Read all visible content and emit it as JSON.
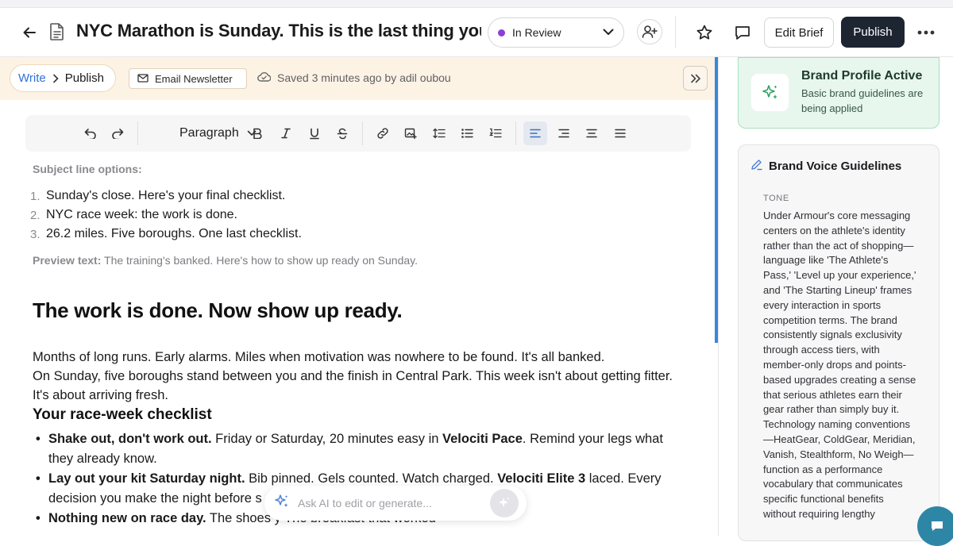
{
  "header": {
    "title": "NYC Marathon is Sunday. This is the last thing you s",
    "status": "In Review",
    "edit_brief_label": "Edit Brief",
    "publish_label": "Publish"
  },
  "subbar": {
    "crumb_write": "Write",
    "crumb_publish": "Publish",
    "email_newsletter": "Email Newsletter",
    "saved_text": "Saved 3 minutes ago by adil oubou"
  },
  "toolbar": {
    "paragraph_label": "Paragraph"
  },
  "doc": {
    "subject_label": "Subject line options:",
    "subject_lines": [
      {
        "num": "1.",
        "text": "Sunday's close. Here's your final checklist."
      },
      {
        "num": "2.",
        "text": "NYC race week: the work is done."
      },
      {
        "num": "3.",
        "text": "26.2 miles. Five boroughs. One last checklist."
      }
    ],
    "preview_label": "Preview text:",
    "preview_text": " The training's banked. Here's how to show up ready on Sunday.",
    "headline": "The work is done. Now show up ready.",
    "para1": "Months of long runs. Early alarms. Miles when motivation was nowhere to be found. It's all banked.",
    "para2": "On Sunday, five boroughs stand between you and the finish in Central Park. This week isn't about getting fitter. It's about arriving fresh.",
    "checklist_heading": "Your race-week checklist",
    "checklist": [
      {
        "bold": "Shake out, don't work out.",
        "text1": " Friday or Saturday, 20 minutes easy in ",
        "bold2": "Velociti Pace",
        "text2": ". Remind your legs what they already know."
      },
      {
        "bold": "Lay out your kit Saturday night.",
        "text1": " Bib pinned. Gels counted. Watch charged. ",
        "bold2": "Velociti Elite 3",
        "text2": " laced. Every decision you make the night before s"
      },
      {
        "bold": "Nothing new on race day.",
        "text1": " The shoes y",
        "bold2": "",
        "text2": "   The breakfast that worked"
      }
    ]
  },
  "ai": {
    "placeholder": "Ask AI to edit or generate..."
  },
  "brand": {
    "title": "Brand Profile Active",
    "subtitle": "Basic brand guidelines are being applied"
  },
  "guidelines": {
    "title": "Brand Voice Guidelines",
    "tone_label": "TONE",
    "tone_text": "Under Armour's core messaging centers on the athlete's identity rather than the act of shopping—language like 'The Athlete's Pass,' 'Level up your experience,' and 'The Starting Lineup' frames every interaction in sports competition terms. The brand consistently signals exclusivity through access tiers, with member-only drops and points-based upgrades creating a sense that serious athletes earn their gear rather than simply buy it. Technology naming conventions—HeatGear, ColdGear, Meridian, Vanish, Stealthform, No Weigh—function as a performance vocabulary that communicates specific functional benefits without requiring lengthy"
  },
  "colors": {
    "accent_blue": "#2f73d6",
    "publish_bg": "#1d2432",
    "status_dot": "#8b3fd8",
    "brand_green_bg": "#e8f7ee",
    "subbar_bg": "#fdf3e5"
  },
  "icons": {
    "back": "arrow-left-icon",
    "doc": "document-icon",
    "add_user": "add-user-icon",
    "star": "star-icon",
    "comment": "comment-icon",
    "more": "more-horizontal-icon",
    "sparkle": "sparkle-icon",
    "pencil": "pencil-icon",
    "chat": "chat-icon"
  }
}
